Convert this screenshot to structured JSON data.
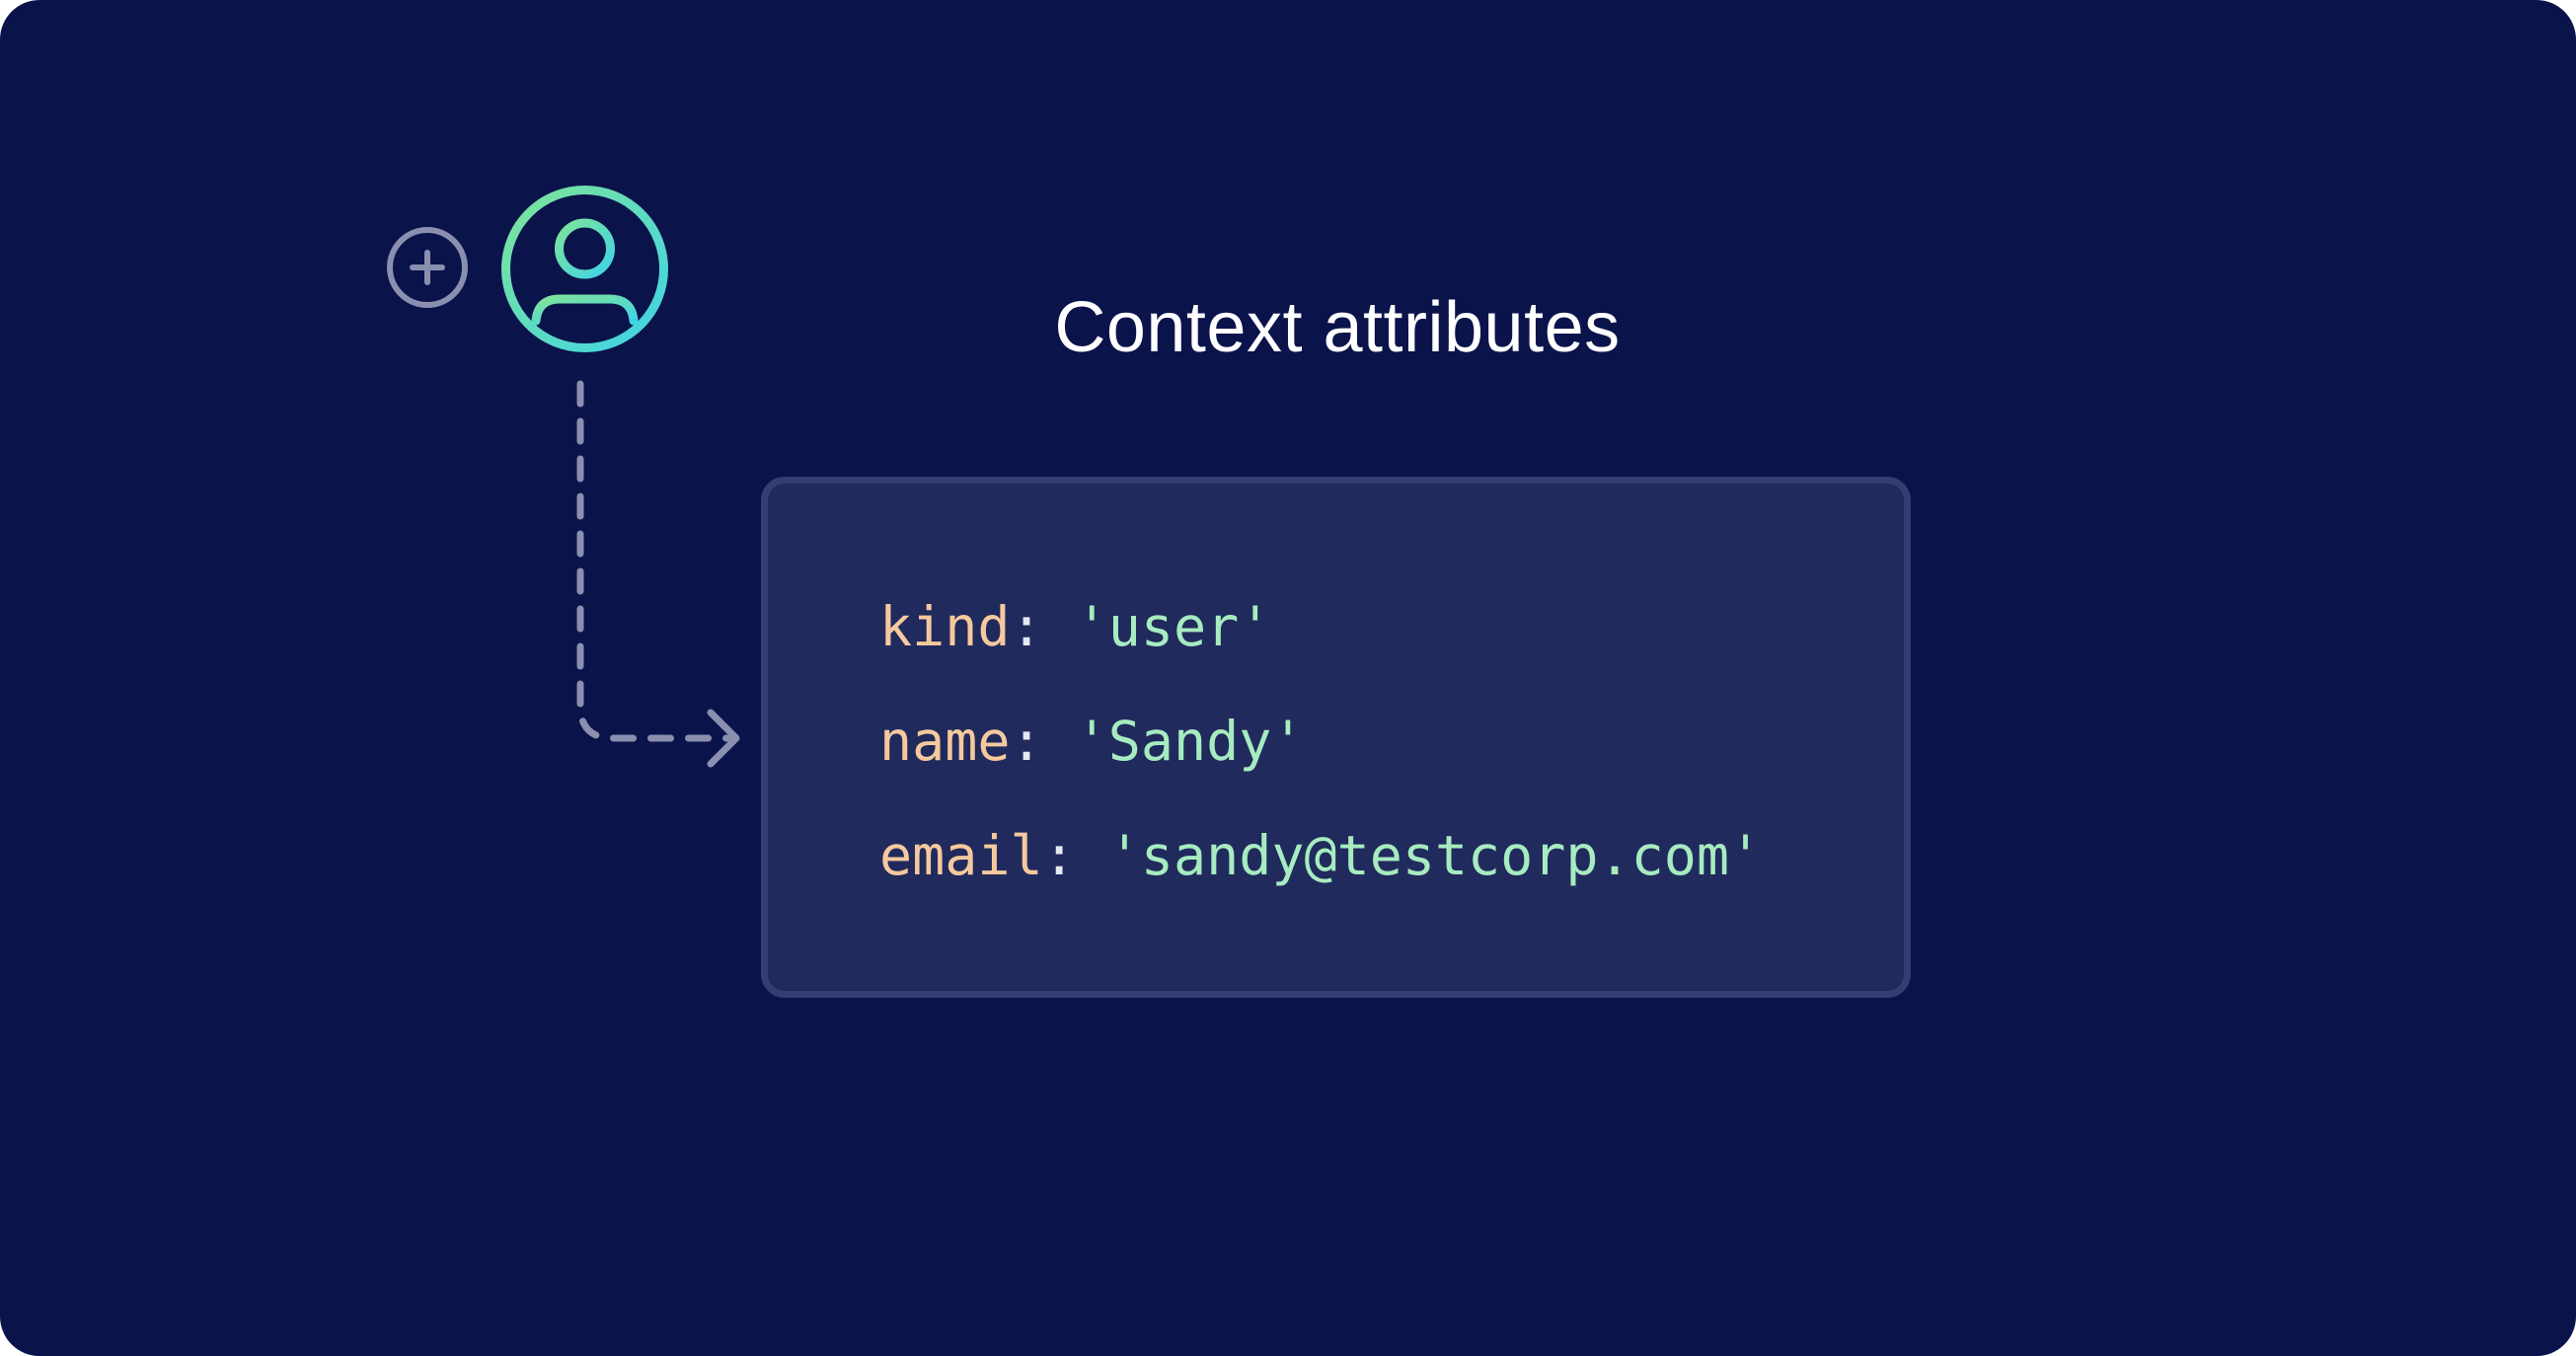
{
  "title": "Context attributes",
  "icons": {
    "add": "plus-circle-icon",
    "context": "user-circle-icon"
  },
  "colors": {
    "background": "#0b134b",
    "card_background": "#212a5c",
    "card_border": "#343e72",
    "key": "#f5c99e",
    "value": "#a6ecc0",
    "icon_gradient_start": "#7ee39a",
    "icon_gradient_end": "#3fd4e6",
    "muted": "#8a8fb0"
  },
  "attributes": [
    {
      "key": "kind",
      "separator": ": ",
      "value": "'user'"
    },
    {
      "key": "name",
      "separator": ": ",
      "value": "'Sandy'"
    },
    {
      "key": "email",
      "separator": ": ",
      "value": "'sandy@testcorp.com'"
    }
  ]
}
